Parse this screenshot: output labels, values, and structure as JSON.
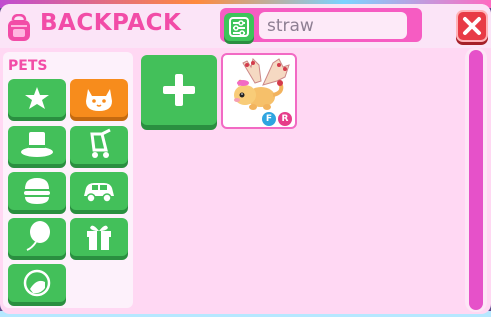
{
  "header": {
    "title": "BACKPACK",
    "icon": "backpack-icon"
  },
  "search": {
    "value": "straw"
  },
  "categories": {
    "label": "PETS",
    "items": [
      {
        "name": "pets-star",
        "icon": "star-icon",
        "active": false
      },
      {
        "name": "pets",
        "icon": "pet-face-icon",
        "active": true
      },
      {
        "name": "accessories",
        "icon": "top-hat-icon",
        "active": false
      },
      {
        "name": "strollers",
        "icon": "stroller-icon",
        "active": false
      },
      {
        "name": "food",
        "icon": "burger-icon",
        "active": false
      },
      {
        "name": "vehicles",
        "icon": "car-icon",
        "active": false
      },
      {
        "name": "toys",
        "icon": "balloon-icon",
        "active": false
      },
      {
        "name": "gifts",
        "icon": "gift-icon",
        "active": false
      },
      {
        "name": "stickers",
        "icon": "sticker-icon",
        "active": false
      }
    ]
  },
  "inventory": {
    "add_icon": "plus-icon",
    "items": [
      {
        "name": "strawberry-shortcake-bat-dragon",
        "badges": [
          "F",
          "R"
        ]
      }
    ]
  },
  "colors": {
    "accent_pink": "#f24ca7",
    "button_green": "#43c05a",
    "active_orange": "#f78c1c",
    "close_red": "#e83b46",
    "badge_f": "#2fa5e0",
    "badge_r": "#e63d8a"
  }
}
